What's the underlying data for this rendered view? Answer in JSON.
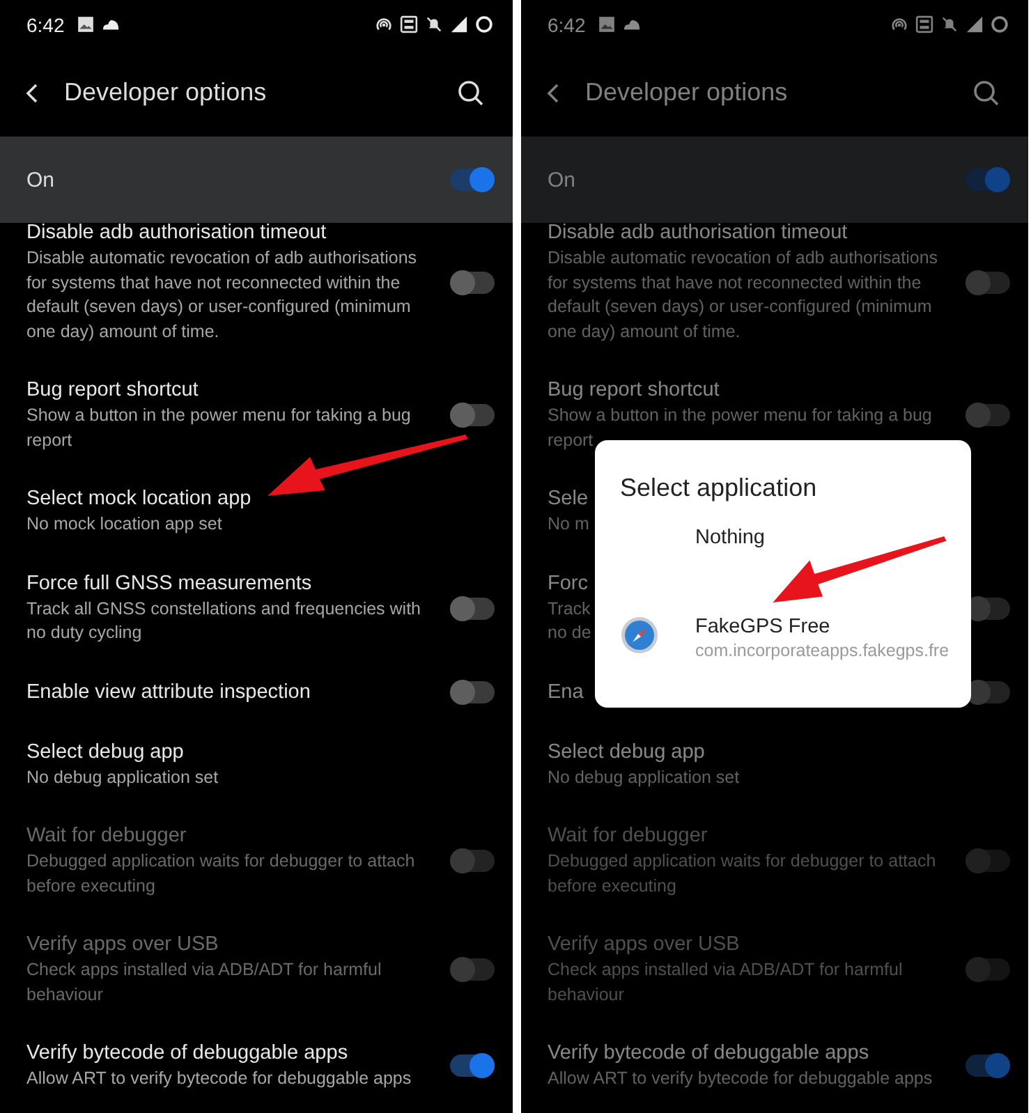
{
  "screens": [
    {
      "status_bar": {
        "time": "6:42"
      },
      "title": "Developer options",
      "master": {
        "label": "On",
        "on": true
      },
      "dimmed": false,
      "settings": [
        {
          "kind": "switch",
          "title": "Disable adb authorisation timeout",
          "summary": "Disable automatic revocation of adb authorisations for systems that have not reconnected within the default (seven days) or user-configured (minimum one day) amount of time.",
          "on": false,
          "disabled": false
        },
        {
          "kind": "switch",
          "title": "Bug report shortcut",
          "summary": "Show a button in the power menu for taking a bug report",
          "on": false,
          "disabled": false
        },
        {
          "kind": "link",
          "title": "Select mock location app",
          "summary": "No mock location app set",
          "disabled": false
        },
        {
          "kind": "switch",
          "title": "Force full GNSS measurements",
          "summary": "Track all GNSS constellations and frequencies with no duty cycling",
          "on": false,
          "disabled": false
        },
        {
          "kind": "switch",
          "title": "Enable view attribute inspection",
          "on": false,
          "disabled": false
        },
        {
          "kind": "link",
          "title": "Select debug app",
          "summary": "No debug application set",
          "disabled": false
        },
        {
          "kind": "switch",
          "title": "Wait for debugger",
          "summary": "Debugged application waits for debugger to attach before executing",
          "on": false,
          "disabled": true
        },
        {
          "kind": "switch",
          "title": "Verify apps over USB",
          "summary": "Check apps installed via ADB/ADT for harmful behaviour",
          "on": false,
          "disabled": true
        },
        {
          "kind": "switch",
          "title": "Verify bytecode of debuggable apps",
          "summary": "Allow ART to verify bytecode for debuggable apps",
          "on": true,
          "disabled": false
        }
      ]
    },
    {
      "status_bar": {
        "time": "6:42"
      },
      "title": "Developer options",
      "master": {
        "label": "On",
        "on": true
      },
      "dimmed": true,
      "settings": [
        {
          "kind": "switch",
          "title": "Disable adb authorisation timeout",
          "summary": "Disable automatic revocation of adb authorisations for systems that have not reconnected within the default (seven days) or user-configured (minimum one day) amount of time.",
          "on": false,
          "disabled": false
        },
        {
          "kind": "switch",
          "title": "Bug report shortcut",
          "summary": "Show a button in the power menu for taking a bug report",
          "on": false,
          "disabled": false
        },
        {
          "kind": "link",
          "title": "Sele",
          "summary": "No m",
          "disabled": false
        },
        {
          "kind": "switch",
          "title": "Forc",
          "summary": "Track\nno de",
          "on": false,
          "disabled": false
        },
        {
          "kind": "switch",
          "title": "Ena",
          "on": false,
          "disabled": false
        },
        {
          "kind": "link",
          "title": "Select debug app",
          "summary": "No debug application set",
          "disabled": false
        },
        {
          "kind": "switch",
          "title": "Wait for debugger",
          "summary": "Debugged application waits for debugger to attach before executing",
          "on": false,
          "disabled": true
        },
        {
          "kind": "switch",
          "title": "Verify apps over USB",
          "summary": "Check apps installed via ADB/ADT for harmful behaviour",
          "on": false,
          "disabled": true
        },
        {
          "kind": "switch",
          "title": "Verify bytecode of debuggable apps",
          "summary": "Allow ART to verify bytecode for debuggable apps",
          "on": true,
          "disabled": false
        }
      ],
      "dialog": {
        "title": "Select application",
        "options": [
          {
            "label": "Nothing"
          },
          {
            "label": "FakeGPS Free",
            "package": "com.incorporateapps.fakegps.fre",
            "icon": true
          }
        ]
      }
    }
  ]
}
